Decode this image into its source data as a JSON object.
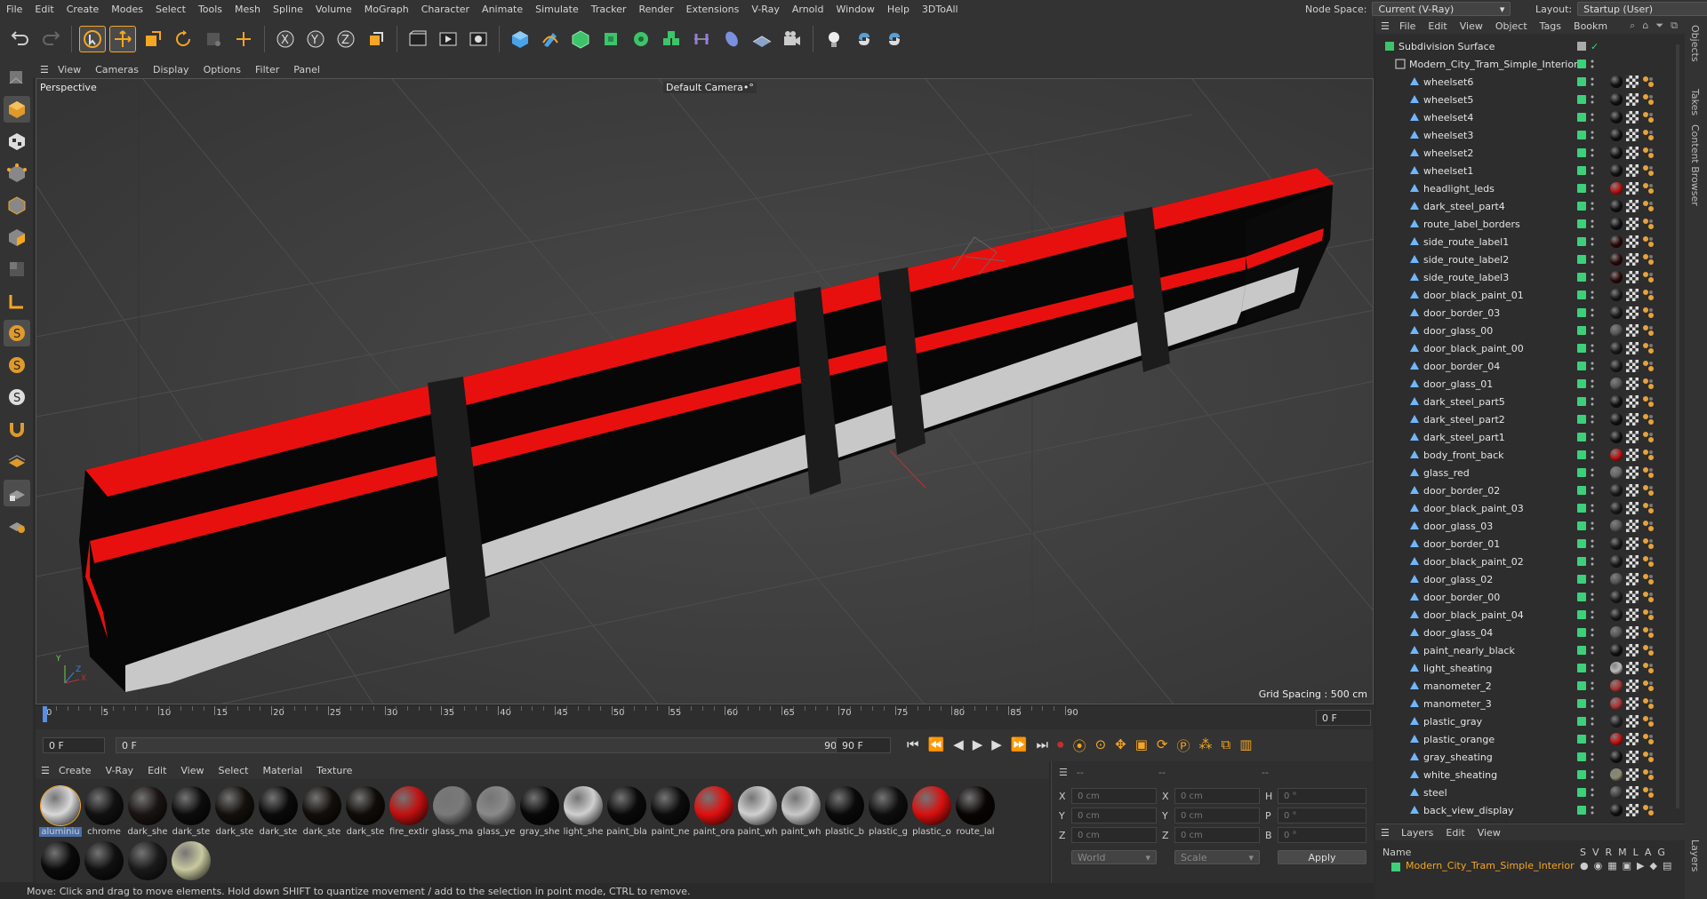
{
  "menubar": {
    "items": [
      "File",
      "Edit",
      "Create",
      "Modes",
      "Select",
      "Tools",
      "Mesh",
      "Spline",
      "Volume",
      "MoGraph",
      "Character",
      "Animate",
      "Simulate",
      "Tracker",
      "Render",
      "Extensions",
      "V-Ray",
      "Arnold",
      "Window",
      "Help",
      "3DToAll"
    ],
    "node_space_label": "Node Space:",
    "node_space_value": "Current (V-Ray)",
    "layout_label": "Layout:",
    "layout_value": "Startup (User)"
  },
  "toolbar": {
    "icons": [
      "undo-icon",
      "redo-icon",
      "select-icon",
      "move-icon",
      "scale-icon",
      "rotate-icon",
      "recent-tools-icon",
      "create-icon",
      "x-axis-icon",
      "y-axis-icon",
      "z-axis-icon",
      "coordinate-system-icon",
      "render-view-icon",
      "render-picture-queue-icon",
      "render-settings-icon",
      "cube-icon",
      "pen-icon",
      "subdivision-icon",
      "extrude-icon",
      "cloner-icon",
      "array-icon",
      "symmetry-icon",
      "deformer-icon",
      "floor-icon",
      "camera-icon",
      "light-icon",
      "python-icon",
      "python-plugin-icon"
    ]
  },
  "viewport_menu": [
    "View",
    "Cameras",
    "Display",
    "Options",
    "Filter",
    "Panel"
  ],
  "viewport": {
    "label": "Perspective",
    "camera": "Default Camera",
    "camera_suffix": "•°",
    "grid_spacing": "Grid Spacing : 500 cm",
    "axis_x": "X",
    "axis_y": "Y",
    "axis_z": "Z"
  },
  "timeline": {
    "ticks": [
      "0",
      "5",
      "10",
      "15",
      "20",
      "25",
      "30",
      "35",
      "40",
      "45",
      "50",
      "55",
      "60",
      "65",
      "70",
      "75",
      "80",
      "85",
      "90"
    ],
    "end_frame": "0 F"
  },
  "transport": {
    "start_field": "0 F",
    "current_field": "0 F",
    "end_field_a": "90 F",
    "end_field_b": "90 F"
  },
  "material_menu": [
    "Create",
    "V-Ray",
    "Edit",
    "View",
    "Select",
    "Material",
    "Texture"
  ],
  "materials": [
    {
      "name": "aluminiu",
      "color": "#d8d8d8",
      "selected": true
    },
    {
      "name": "chrome",
      "color": "#111111"
    },
    {
      "name": "dark_she",
      "color": "#1a1412"
    },
    {
      "name": "dark_ste",
      "color": "#0c0c0c"
    },
    {
      "name": "dark_ste",
      "color": "#14100c"
    },
    {
      "name": "dark_ste",
      "color": "#0a0a0a"
    },
    {
      "name": "dark_ste",
      "color": "#120e0a"
    },
    {
      "name": "dark_ste",
      "color": "#100c08"
    },
    {
      "name": "fire_extir",
      "color": "#c01010"
    },
    {
      "name": "glass_ma",
      "color": "#7a7a7a"
    },
    {
      "name": "glass_ye",
      "color": "#8a8a8a"
    },
    {
      "name": "gray_she",
      "color": "#080808"
    },
    {
      "name": "light_she",
      "color": "#cfcfcf"
    },
    {
      "name": "paint_bla",
      "color": "#0a0a0a"
    },
    {
      "name": "paint_ne",
      "color": "#0c0c0c"
    },
    {
      "name": "paint_ora",
      "color": "#e01010"
    },
    {
      "name": "paint_wh",
      "color": "#d0d0d0"
    },
    {
      "name": "paint_wh",
      "color": "#c8c8c8"
    },
    {
      "name": "plastic_b",
      "color": "#0a0a0a"
    },
    {
      "name": "plastic_g",
      "color": "#0e0e0e"
    },
    {
      "name": "plastic_o",
      "color": "#d81010"
    },
    {
      "name": "route_lal",
      "color": "#0a0404"
    },
    {
      "name": "",
      "color": "#0a0a0a"
    },
    {
      "name": "",
      "color": "#101010"
    },
    {
      "name": "",
      "color": "#1a1a1a"
    },
    {
      "name": "",
      "color": "#c8c8a0"
    }
  ],
  "coords": {
    "header_a": "--",
    "header_b": "--",
    "header_c": "--",
    "x_pos": "0 cm",
    "y_pos": "0 cm",
    "z_pos": "0 cm",
    "x_size": "0 cm",
    "y_size": "0 cm",
    "z_size": "0 cm",
    "h_rot": "0 °",
    "p_rot": "0 °",
    "b_rot": "0 °",
    "label_x": "X",
    "label_y": "Y",
    "label_z": "Z",
    "label_h": "H",
    "label_p": "P",
    "label_b": "B",
    "world": "World",
    "scale": "Scale",
    "apply": "Apply"
  },
  "status": "Move: Click and drag to move elements. Hold down SHIFT to quantize movement / add to the selection in point mode, CTRL to remove.",
  "objects_menu": [
    "File",
    "Edit",
    "View",
    "Object",
    "Tags",
    "Bookm"
  ],
  "objects": [
    {
      "name": "Subdivision Surface",
      "level": 0,
      "kind": "subd"
    },
    {
      "name": "Modern_City_Tram_Simple_Interior",
      "level": 1,
      "kind": "null"
    },
    {
      "name": "wheelset6",
      "level": 2,
      "tag": "#111111"
    },
    {
      "name": "wheelset5",
      "level": 2,
      "tag": "#111111"
    },
    {
      "name": "wheelset4",
      "level": 2,
      "tag": "#111111"
    },
    {
      "name": "wheelset3",
      "level": 2,
      "tag": "#111111"
    },
    {
      "name": "wheelset2",
      "level": 2,
      "tag": "#111111"
    },
    {
      "name": "wheelset1",
      "level": 2,
      "tag": "#111111"
    },
    {
      "name": "headlight_leds",
      "level": 2,
      "tag": "#c01010"
    },
    {
      "name": "dark_steel_part4",
      "level": 2,
      "tag": "#111111"
    },
    {
      "name": "route_label_borders",
      "level": 2,
      "tag": "#111111"
    },
    {
      "name": "side_route_label1",
      "level": 2,
      "tag": "#2a0808"
    },
    {
      "name": "side_route_label2",
      "level": 2,
      "tag": "#2a0808"
    },
    {
      "name": "side_route_label3",
      "level": 2,
      "tag": "#2a0808"
    },
    {
      "name": "door_black_paint_01",
      "level": 2,
      "tag": "#1a1a1a"
    },
    {
      "name": "door_border_03",
      "level": 2,
      "tag": "#1a1a1a"
    },
    {
      "name": "door_glass_00",
      "level": 2,
      "tag": "#555555"
    },
    {
      "name": "door_black_paint_00",
      "level": 2,
      "tag": "#1a1a1a"
    },
    {
      "name": "door_border_04",
      "level": 2,
      "tag": "#1a1a1a"
    },
    {
      "name": "door_glass_01",
      "level": 2,
      "tag": "#555555"
    },
    {
      "name": "dark_steel_part5",
      "level": 2,
      "tag": "#111111"
    },
    {
      "name": "dark_steel_part2",
      "level": 2,
      "tag": "#111111"
    },
    {
      "name": "dark_steel_part1",
      "level": 2,
      "tag": "#111111"
    },
    {
      "name": "body_front_back",
      "level": 2,
      "tag": "#c01010"
    },
    {
      "name": "glass_red",
      "level": 2,
      "tag": "#666666"
    },
    {
      "name": "door_border_02",
      "level": 2,
      "tag": "#1a1a1a"
    },
    {
      "name": "door_black_paint_03",
      "level": 2,
      "tag": "#1a1a1a"
    },
    {
      "name": "door_glass_03",
      "level": 2,
      "tag": "#555555"
    },
    {
      "name": "door_border_01",
      "level": 2,
      "tag": "#1a1a1a"
    },
    {
      "name": "door_black_paint_02",
      "level": 2,
      "tag": "#1a1a1a"
    },
    {
      "name": "door_glass_02",
      "level": 2,
      "tag": "#555555"
    },
    {
      "name": "door_border_00",
      "level": 2,
      "tag": "#1a1a1a"
    },
    {
      "name": "door_black_paint_04",
      "level": 2,
      "tag": "#1a1a1a"
    },
    {
      "name": "door_glass_04",
      "level": 2,
      "tag": "#555555"
    },
    {
      "name": "paint_nearly_black",
      "level": 2,
      "tag": "#111111"
    },
    {
      "name": "light_sheating",
      "level": 2,
      "tag": "#bbbbbb"
    },
    {
      "name": "manometer_2",
      "level": 2,
      "tag": "#aa3333"
    },
    {
      "name": "manometer_3",
      "level": 2,
      "tag": "#aa3333"
    },
    {
      "name": "plastic_gray",
      "level": 2,
      "tag": "#222222"
    },
    {
      "name": "plastic_orange",
      "level": 2,
      "tag": "#c81010"
    },
    {
      "name": "gray_sheating",
      "level": 2,
      "tag": "#111111"
    },
    {
      "name": "white_sheating",
      "level": 2,
      "tag": "#8a8a70"
    },
    {
      "name": "steel",
      "level": 2,
      "tag": "#444444"
    },
    {
      "name": "back_view_display",
      "level": 2,
      "tag": "#111111"
    }
  ],
  "layers_menu": [
    "Layers",
    "Edit",
    "View"
  ],
  "layers": {
    "name_header": "Name",
    "cols": [
      "S",
      "V",
      "R",
      "M",
      "L",
      "A",
      "G"
    ],
    "row_name": "Modern_City_Tram_Simple_Interior",
    "row_color": "#3dd07a"
  },
  "side_tabs": [
    "Objects",
    "Takes",
    "Content Browser",
    "Layers"
  ]
}
